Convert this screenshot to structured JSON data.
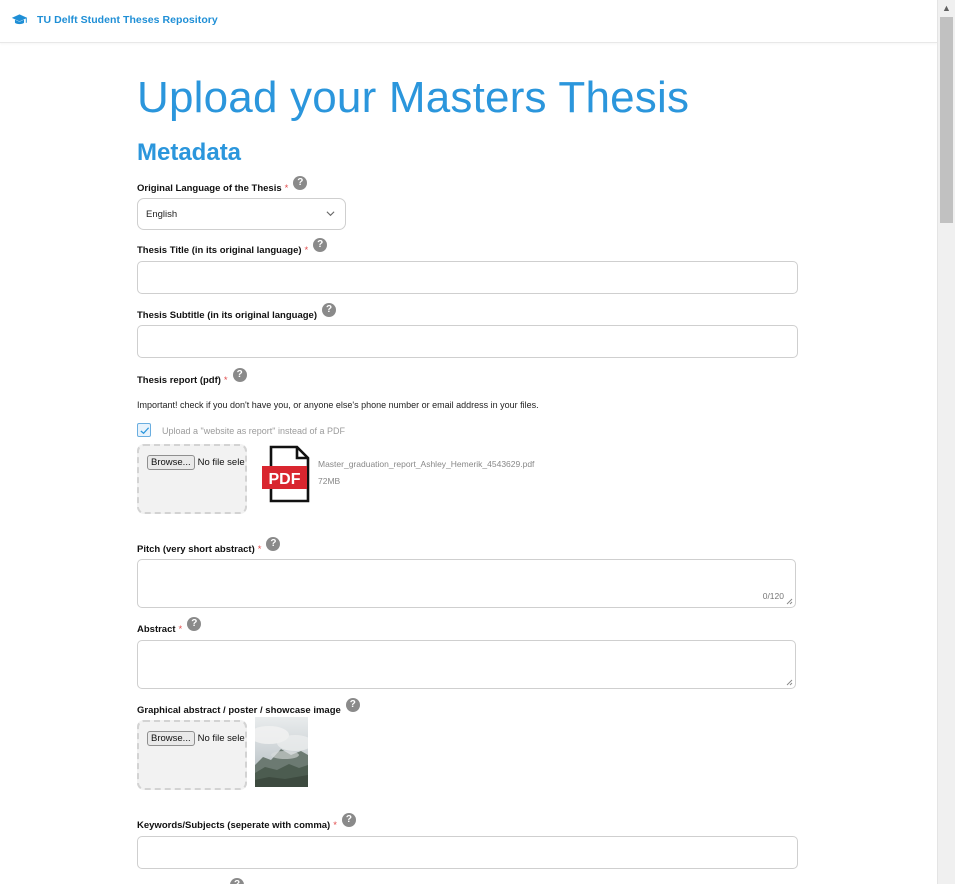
{
  "header": {
    "app_name": "TU Delft Student Theses Repository",
    "logo_icon": "graduation-cap-icon",
    "brand_color": "#1f8fd6"
  },
  "page": {
    "title": "Upload your Masters Thesis",
    "section": "Metadata",
    "accent_color": "#2b96dc"
  },
  "form": {
    "required_mark": "*",
    "help_glyph": "?",
    "language": {
      "label": "Original Language of the Thesis",
      "value": "English"
    },
    "title": {
      "label": "Thesis Title (in its original language)",
      "value": ""
    },
    "subtitle": {
      "label": "Thesis Subtitle (in its original language)",
      "value": ""
    },
    "report": {
      "label": "Thesis report (pdf)",
      "note": "Important! check if you don't have you, or anyone else's phone number or email address in your files.",
      "website_checkbox_label": "Upload a \"website as report\" instead of a PDF",
      "website_checked": true,
      "browse_label": "Browse...",
      "no_file_text": "No file selected.",
      "pdf_icon_text": "PDF",
      "file_name": "Master_graduation_report_Ashley_Hemerik_4543629.pdf",
      "file_size": "72MB"
    },
    "pitch": {
      "label": "Pitch (very short abstract)",
      "counter": "0/120",
      "value": ""
    },
    "abstract": {
      "label": "Abstract",
      "value": ""
    },
    "image": {
      "label": "Graphical abstract / poster / showcase image",
      "browse_label": "Browse...",
      "no_file_text": "No file selected."
    },
    "keywords": {
      "label": "Keywords/Subjects (seperate with comma)",
      "value": ""
    }
  }
}
